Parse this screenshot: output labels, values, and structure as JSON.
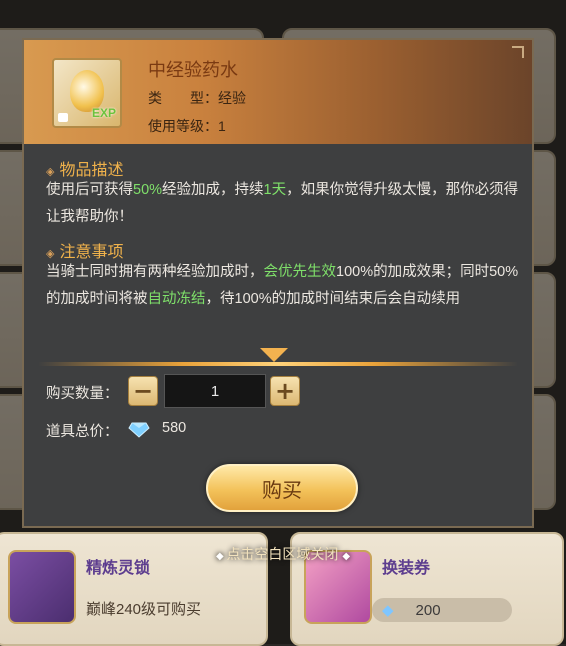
{
  "popup": {
    "item_name": "中经验药水",
    "type_label": "类　　型：",
    "type_value": "经验",
    "level_label": "使用等级：",
    "level_value": "1",
    "desc_title": "物品描述",
    "desc_parts": [
      "使用后可获得",
      "50%",
      "经验加成，持续",
      "1天",
      "，如果你觉得升级太慢，那你必须得让我帮助你！"
    ],
    "notes_title": "注意事项",
    "notes_parts": [
      "当骑士同时拥有两种经验加成时，",
      "会优先生效",
      "100%的加成效果；同时50%的加成时间将被",
      "自动冻结",
      "，待100%的加成时间结束后会自动续用"
    ],
    "qty_label": "购买数量：",
    "qty_value": "1",
    "total_label": "道具总价：",
    "total_value": "580",
    "buy_label": "购买",
    "icon_badge": "EXP"
  },
  "close_hint": "点击空白区域关闭",
  "shop_items": [
    {
      "name": "精炼灵锁",
      "subtitle": "巅峰240级可购买"
    },
    {
      "name": "换装券",
      "price": "200"
    }
  ],
  "colors": {
    "highlight": "#7fe06a",
    "title": "#7a3a12",
    "section": "#f0b24b"
  }
}
